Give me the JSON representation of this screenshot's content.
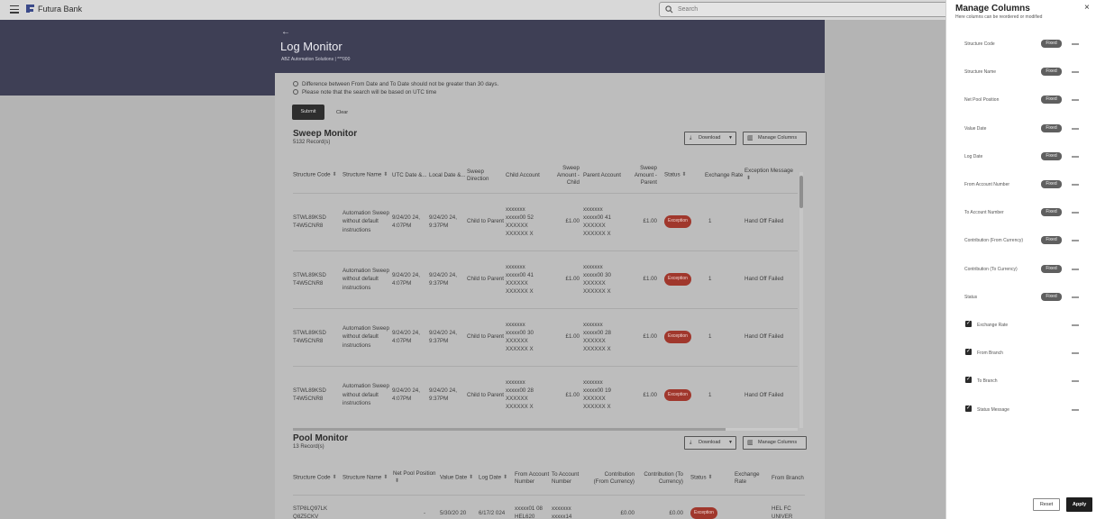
{
  "app": {
    "brand": "Futura Bank"
  },
  "search": {
    "placeholder": "Search"
  },
  "page": {
    "back": "←",
    "title": "Log Monitor",
    "subtitle": "ABZ Automation Solutions | ***000"
  },
  "notes": [
    "Difference between From Date and To Date should not be greater than 30 days.",
    "Please note that the search will be based on UTC time"
  ],
  "buttons": {
    "submit": "Submit",
    "clear": "Clear"
  },
  "sweep": {
    "title": "Sweep Monitor",
    "count": "5132 Record(s)",
    "download": "Download",
    "manage": "Manage Columns",
    "headers": [
      "Structure Code",
      "Structure Name",
      "UTC Date &...",
      "Local Date &...",
      "Sweep Direction",
      "Child Account",
      "Sweep Amount - Child",
      "Parent Account",
      "Sweep Amount - Parent",
      "Status",
      "Exchange Rate",
      "Exception Message"
    ],
    "rows": [
      {
        "code": "STWL89KSD T4W5CNR8",
        "name": "Automation Sweep without default instructions",
        "utc": "9/24/20 24, 4:07PM",
        "local": "9/24/20 24, 9:37PM",
        "direction": "Child to Parent",
        "child": "xxxxxxx xxxxx00 52 XXXXXX XXXXXX X",
        "amt_child": "£1.00",
        "parent": "xxxxxxx xxxxx00 41 XXXXXX XXXXXX X",
        "amt_parent": "£1.00",
        "status": "Exception",
        "rate": "1",
        "message": "Hand Off Failed"
      },
      {
        "code": "STWL89KSD T4W5CNR8",
        "name": "Automation Sweep without default instructions",
        "utc": "9/24/20 24, 4:07PM",
        "local": "9/24/20 24, 9:37PM",
        "direction": "Child to Parent",
        "child": "xxxxxxx xxxxx00 41 XXXXXX XXXXXX X",
        "amt_child": "£1.00",
        "parent": "xxxxxxx xxxxx00 30 XXXXXX XXXXXX X",
        "amt_parent": "£1.00",
        "status": "Exception",
        "rate": "1",
        "message": "Hand Off Failed"
      },
      {
        "code": "STWL89KSD T4W5CNR8",
        "name": "Automation Sweep without default instructions",
        "utc": "9/24/20 24, 4:07PM",
        "local": "9/24/20 24, 9:37PM",
        "direction": "Child to Parent",
        "child": "xxxxxxx xxxxx00 30 XXXXXX XXXXXX X",
        "amt_child": "£1.00",
        "parent": "xxxxxxx xxxxx00 28 XXXXXX XXXXXX X",
        "amt_parent": "£1.00",
        "status": "Exception",
        "rate": "1",
        "message": "Hand Off Failed"
      },
      {
        "code": "STWL89KSD T4W5CNR8",
        "name": "Automation Sweep without default instructions",
        "utc": "9/24/20 24, 4:07PM",
        "local": "9/24/20 24, 9:37PM",
        "direction": "Child to Parent",
        "child": "xxxxxxx xxxxx00 28 XXXXXX XXXXXX X",
        "amt_child": "£1.00",
        "parent": "xxxxxxx xxxxx00 19 XXXXXX XXXXXX X",
        "amt_parent": "£1.00",
        "status": "Exception",
        "rate": "1",
        "message": "Hand Off Failed"
      }
    ]
  },
  "pool": {
    "title": "Pool Monitor",
    "count": "13 Record(s)",
    "download": "Download",
    "manage": "Manage Columns",
    "headers": [
      "Structure Code",
      "Structure Name",
      "Net Pool Position",
      "Value Date",
      "Log Date",
      "From Account Number",
      "To Account Number",
      "Contribution (From Currency)",
      "Contribution (To Currency)",
      "Status",
      "Exchange Rate",
      "From Branch"
    ],
    "row": {
      "code": "STP8LQ97LK Q8Z5CKV",
      "name": "",
      "net": "-",
      "value_date": "5/30/20 20",
      "log_date": "6/17/2 024",
      "from_acct": "xxxxx01 08 HEL620",
      "to_acct": "xxxxxxx xxxxx14",
      "contrib_from": "£0.00",
      "contrib_to": "£0.00",
      "status": "Exception",
      "rate": "",
      "branch": "HEL FC UNIVER"
    }
  },
  "drawer": {
    "title": "Manage Columns",
    "subtitle": "Here columns can be reordered or modified",
    "close": "×",
    "fixed_label": "Fixed",
    "fixed_columns": [
      "Structure Code",
      "Structure Name",
      "Net Pool Position",
      "Value Date",
      "Log Date",
      "From Account Number",
      "To Account Number",
      "Contribution (From Currency)",
      "Contribution (To Currency)",
      "Status"
    ],
    "optional_columns": [
      "Exchange Rate",
      "From Branch",
      "To Branch",
      "Status Message"
    ],
    "reset": "Reset",
    "apply": "Apply"
  }
}
